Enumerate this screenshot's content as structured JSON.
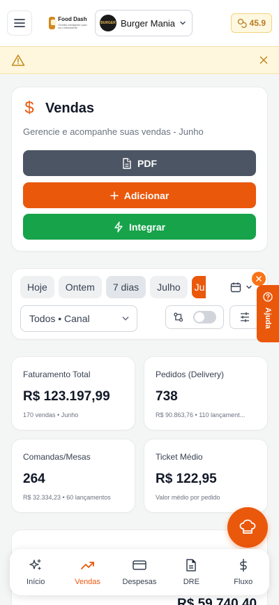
{
  "header": {
    "brand_name": "Food Dash",
    "brand_tagline": "Gestão inteligente para seu restaurante",
    "store_avatar_text": "BURGER",
    "store_name": "Burger Mania",
    "coins": "45.9"
  },
  "sales": {
    "title": "Vendas",
    "subtitle": "Gerencie e acompanhe suas vendas - Junho",
    "pdf_label": "PDF",
    "add_label": "Adicionar",
    "integrate_label": "Integrar"
  },
  "filters": {
    "chips": [
      "Hoje",
      "Ontem",
      "7 dias",
      "Julho",
      "Ju"
    ],
    "channel": "Todos • Canal"
  },
  "help": {
    "label": "Ajuda"
  },
  "metrics": [
    {
      "label": "Faturamento Total",
      "value": "R$ 123.197,99",
      "sub": "170 vendas • Junho"
    },
    {
      "label": "Pedidos (Delivery)",
      "value": "738",
      "sub": "R$ 90.863,76 • 110 lançament..."
    },
    {
      "label": "Comandas/Mesas",
      "value": "264",
      "sub": "R$ 32.334,23 • 60 lançamentos"
    },
    {
      "label": "Ticket Médio",
      "value": "R$ 122,95",
      "sub": "Valor médio por pedido"
    }
  ],
  "peek": {
    "value": "R$ 59.740,40"
  },
  "nav": [
    {
      "label": "Início",
      "icon": "sparkles-icon"
    },
    {
      "label": "Vendas",
      "icon": "trending-up-icon"
    },
    {
      "label": "Despesas",
      "icon": "card-icon"
    },
    {
      "label": "DRE",
      "icon": "document-icon"
    },
    {
      "label": "Fluxo",
      "icon": "dollar-icon"
    }
  ],
  "colors": {
    "accent": "#ea580c",
    "green": "#16a34a",
    "slate": "#4b5563",
    "alert_bg": "#fff7dd"
  }
}
